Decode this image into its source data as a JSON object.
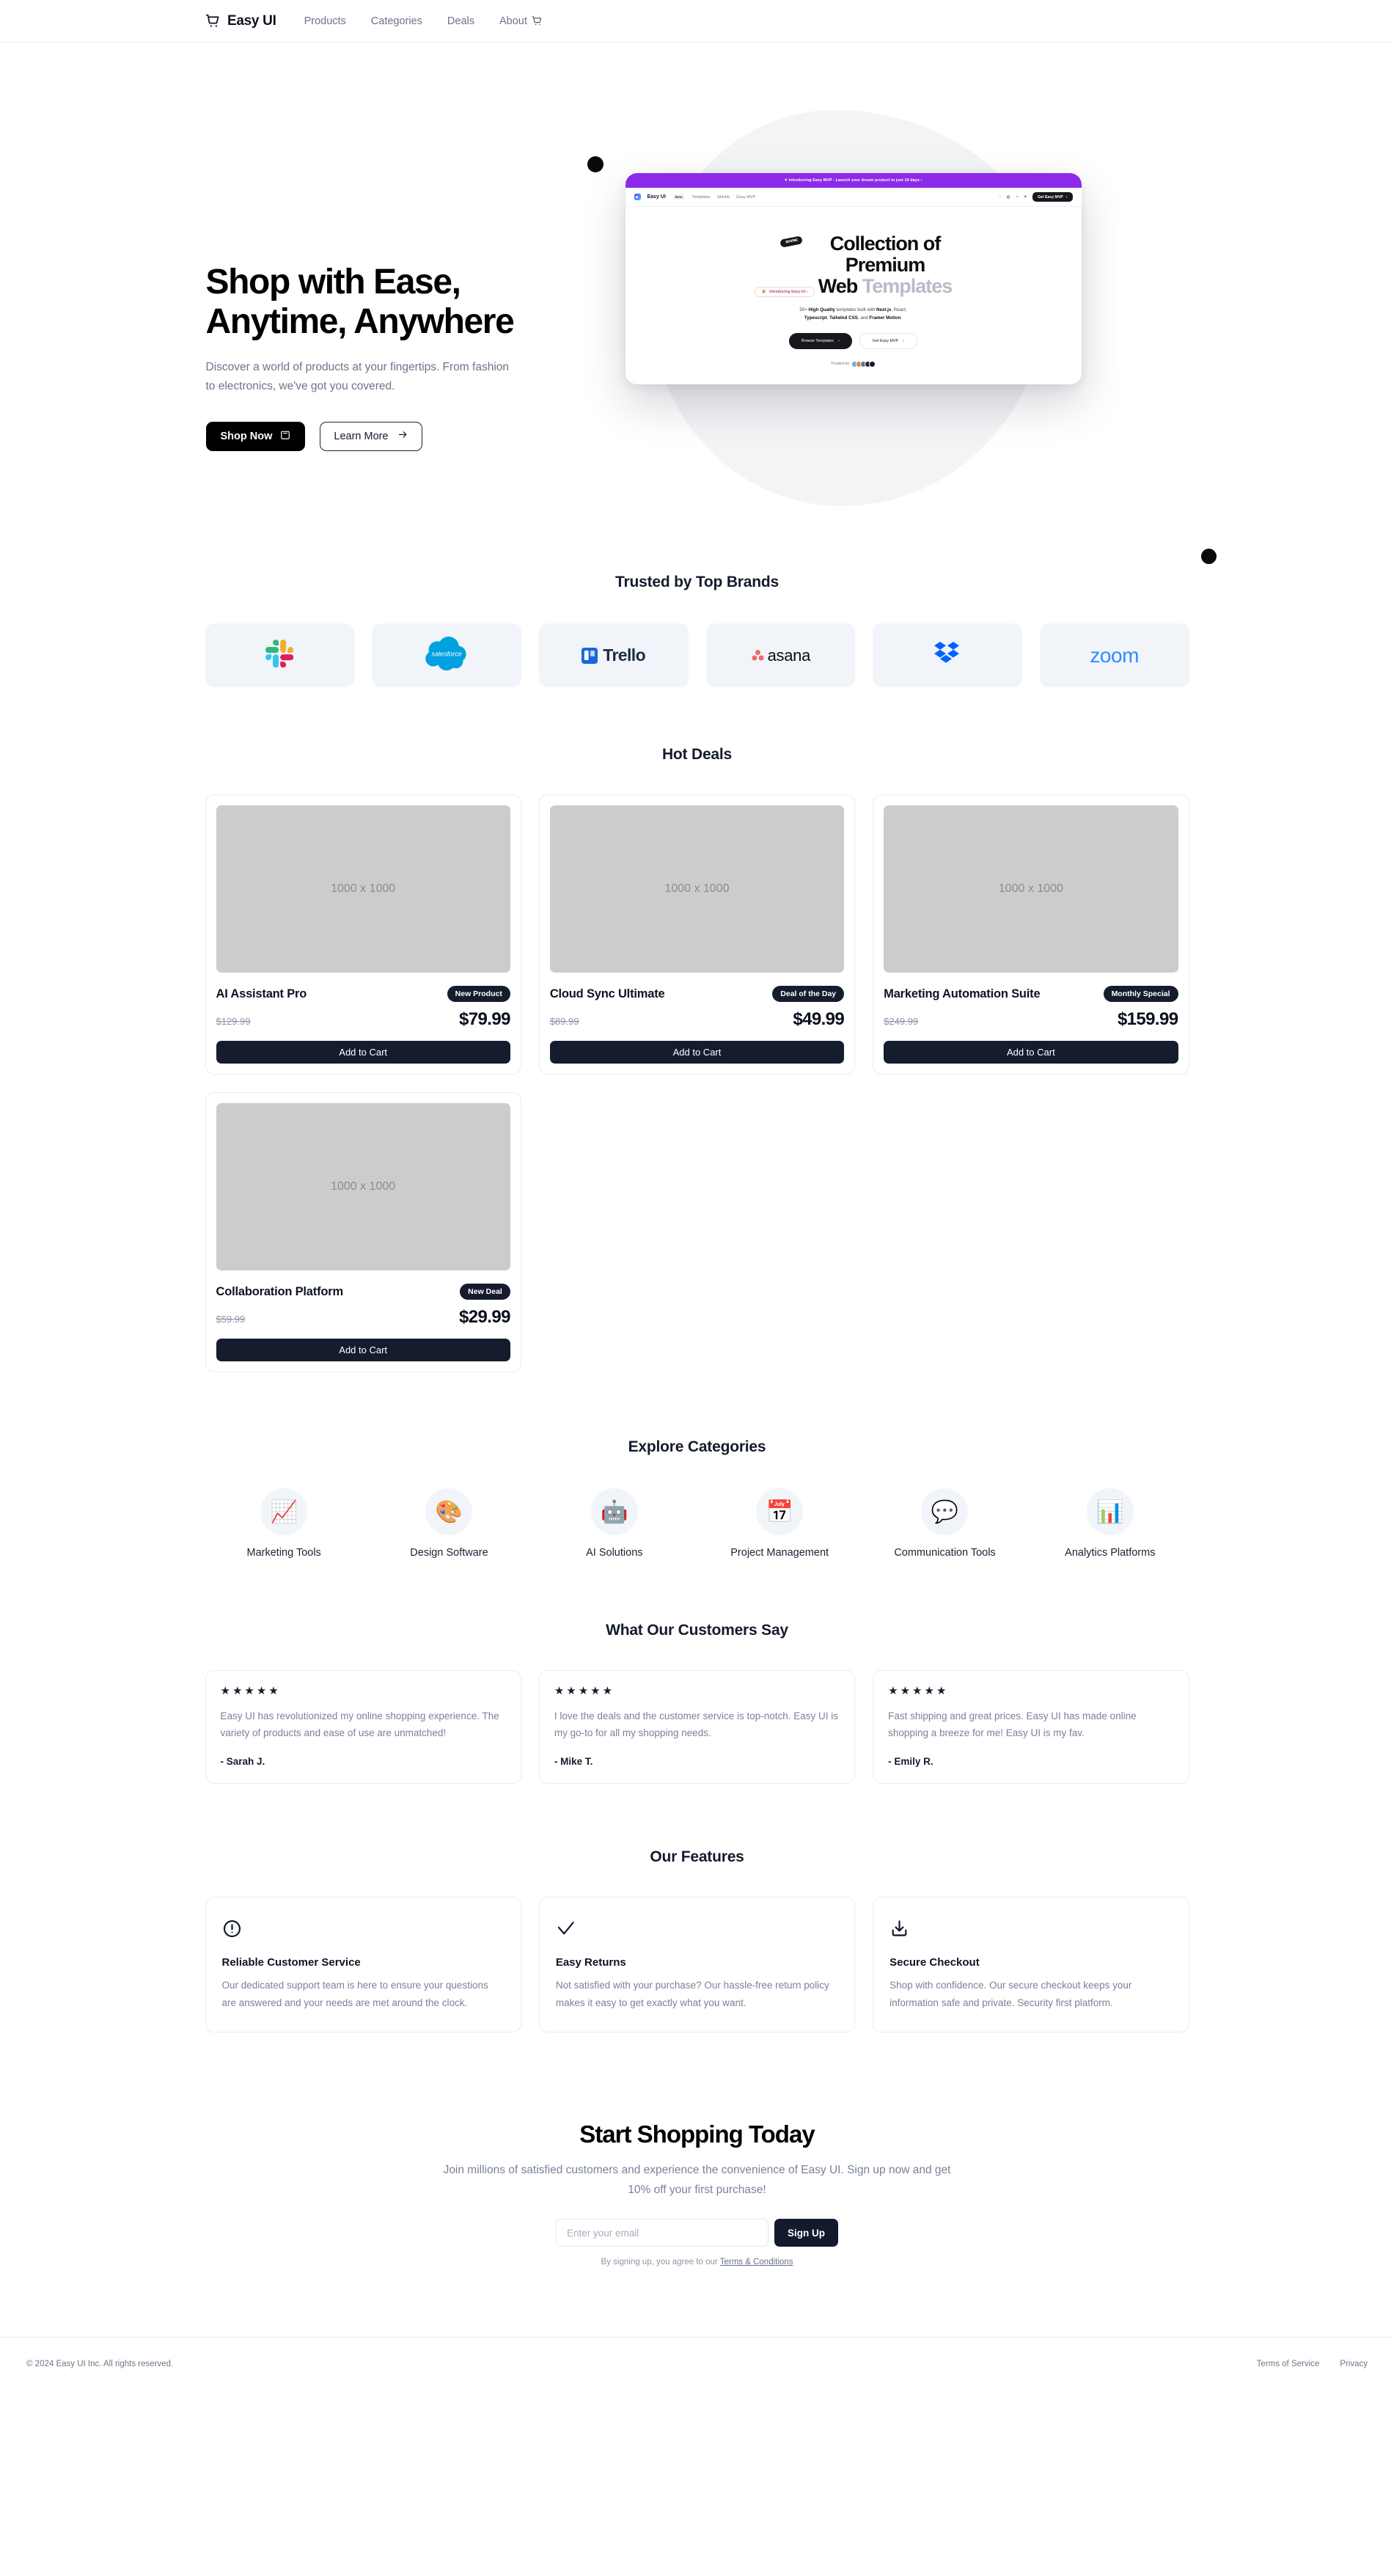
{
  "nav": {
    "brand": "Easy UI",
    "brand_icon": "shopping-cart-icon",
    "links": [
      "Products",
      "Categories",
      "Deals",
      "About"
    ],
    "cart_icon": "cart-icon"
  },
  "hero": {
    "title_line1": "Shop with Ease,",
    "title_line2": "Anytime, Anywhere",
    "subtitle": "Discover a world of products at your fingertips. From fashion to electronics, we've got you covered.",
    "primary_button": "Shop Now",
    "primary_button_icon": "bag-icon",
    "secondary_button": "Learn More",
    "secondary_button_icon": "arrow-right-icon",
    "mockup": {
      "banner": "✦ Introducing Easy MVP - Launch your dream product in just 15 days  ›",
      "brand": "Easy UI",
      "beta": "Beta",
      "nav_links": [
        "Templates",
        "GitHub",
        "Easy MVP"
      ],
      "cta": "Get Easy MVP",
      "pill": "Introducing Easy-UI ›",
      "free_badge": "100% FREE",
      "h1_line1": "Collection of",
      "h1_line2": "Premium",
      "h1_line3a": "Web ",
      "h1_line3b": "Templates",
      "desc_line1_pre": "50+ ",
      "desc_line1_b1": "High Quality",
      "desc_line1_mid": " templates built with ",
      "desc_line1_b2": "Next.js",
      "desc_line1_post": ", React,",
      "desc_line2_b1": "Typescript",
      "desc_line2_mid": ", ",
      "desc_line2_b2": "Tailwind CSS",
      "desc_line2_mid2": ", and ",
      "desc_line2_b3": "Framer Motion",
      "desc_line2_post": ".",
      "btn1": "Browse Templates",
      "btn2": "Get Easy MVP",
      "trusted_by": "Trusted by"
    }
  },
  "brands": {
    "title": "Trusted by Top Brands",
    "items": [
      {
        "name": "Slack",
        "icon": "slack-logo"
      },
      {
        "name": "salesforce",
        "icon": "salesforce-logo"
      },
      {
        "name": "Trello",
        "icon": "trello-logo"
      },
      {
        "name": "asana",
        "icon": "asana-logo"
      },
      {
        "name": "Dropbox",
        "icon": "dropbox-logo"
      },
      {
        "name": "zoom",
        "icon": "zoom-logo"
      }
    ]
  },
  "deals": {
    "title": "Hot Deals",
    "placeholder_text": "1000 x 1000",
    "add_to_cart_label": "Add to Cart",
    "products": [
      {
        "name": "AI Assistant Pro",
        "badge": "New Product",
        "old_price": "$129.99",
        "new_price": "$79.99"
      },
      {
        "name": "Cloud Sync Ultimate",
        "badge": "Deal of the Day",
        "old_price": "$89.99",
        "new_price": "$49.99"
      },
      {
        "name": "Marketing Automation Suite",
        "badge": "Monthly Special",
        "old_price": "$249.99",
        "new_price": "$159.99"
      },
      {
        "name": "Collaboration Platform",
        "badge": "New Deal",
        "old_price": "$59.99",
        "new_price": "$29.99"
      }
    ]
  },
  "categories": {
    "title": "Explore Categories",
    "items": [
      {
        "label": "Marketing Tools",
        "emoji": "📈",
        "icon": "chart-increasing-icon"
      },
      {
        "label": "Design Software",
        "emoji": "🎨",
        "icon": "artist-palette-icon"
      },
      {
        "label": "AI Solutions",
        "emoji": "🤖",
        "icon": "robot-icon"
      },
      {
        "label": "Project Management",
        "emoji": "📅",
        "icon": "calendar-icon"
      },
      {
        "label": "Communication Tools",
        "emoji": "💬",
        "icon": "speech-balloon-icon"
      },
      {
        "label": "Analytics Platforms",
        "emoji": "📊",
        "icon": "bar-chart-icon"
      }
    ]
  },
  "testimonials": {
    "title": "What Our Customers Say",
    "stars": "★★★★★",
    "items": [
      {
        "text": "Easy UI has revolutionized my online shopping experience. The variety of products and ease of use are unmatched!",
        "author": "- Sarah J."
      },
      {
        "text": "I love the deals and the customer service is top-notch. Easy UI is my go-to for all my shopping needs.",
        "author": "- Mike T."
      },
      {
        "text": "Fast shipping and great prices. Easy UI has made online shopping a breeze for me! Easy UI is my fav.",
        "author": "- Emily R."
      }
    ]
  },
  "features": {
    "title": "Our Features",
    "items": [
      {
        "icon": "alert-circle-icon",
        "title": "Reliable Customer Service",
        "desc": "Our dedicated support team is here to ensure your questions are answered and your needs are met around the clock."
      },
      {
        "icon": "check-icon",
        "title": "Easy Returns",
        "desc": "Not satisfied with your purchase? Our hassle-free return policy makes it easy to get exactly what you want."
      },
      {
        "icon": "download-icon",
        "title": "Secure Checkout",
        "desc": "Shop with confidence. Our secure checkout keeps your information safe and private. Security first platform."
      }
    ]
  },
  "cta": {
    "title": "Start Shopping Today",
    "subtitle": "Join millions of satisfied customers and experience the convenience of Easy UI. Sign up now and get 10% off your first purchase!",
    "email_placeholder": "Enter your email",
    "email_value": "",
    "submit_label": "Sign Up",
    "terms_prefix": "By signing up, you agree to our ",
    "terms_link": "Terms & Conditions"
  },
  "footer": {
    "copyright": "© 2024 Easy UI Inc. All rights reserved.",
    "links": [
      "Terms of Service",
      "Privacy"
    ]
  }
}
